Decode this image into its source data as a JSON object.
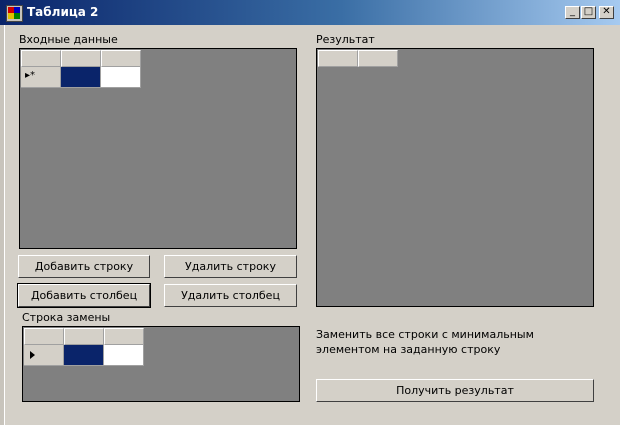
{
  "window": {
    "title": "Таблица 2",
    "caption_buttons": {
      "minimize": "_",
      "maximize": "□",
      "close": "✕"
    }
  },
  "input_section": {
    "label": "Входные данные",
    "new_row_marker": "▸*"
  },
  "result_section": {
    "label": "Результат"
  },
  "buttons": {
    "add_row": "Добавить строку",
    "delete_row": "Удалить строку",
    "add_column": "Добавить столбец",
    "delete_column": "Удалить столбец",
    "get_result": "Получить результат"
  },
  "replacement_section": {
    "label": "Строка замены"
  },
  "task_description": "Заменить все строки с минимальным элементом на заданную строку",
  "colors": {
    "selected_cell": "#0a246a",
    "grid_background": "#808080",
    "form_background": "#d4d0c8"
  }
}
